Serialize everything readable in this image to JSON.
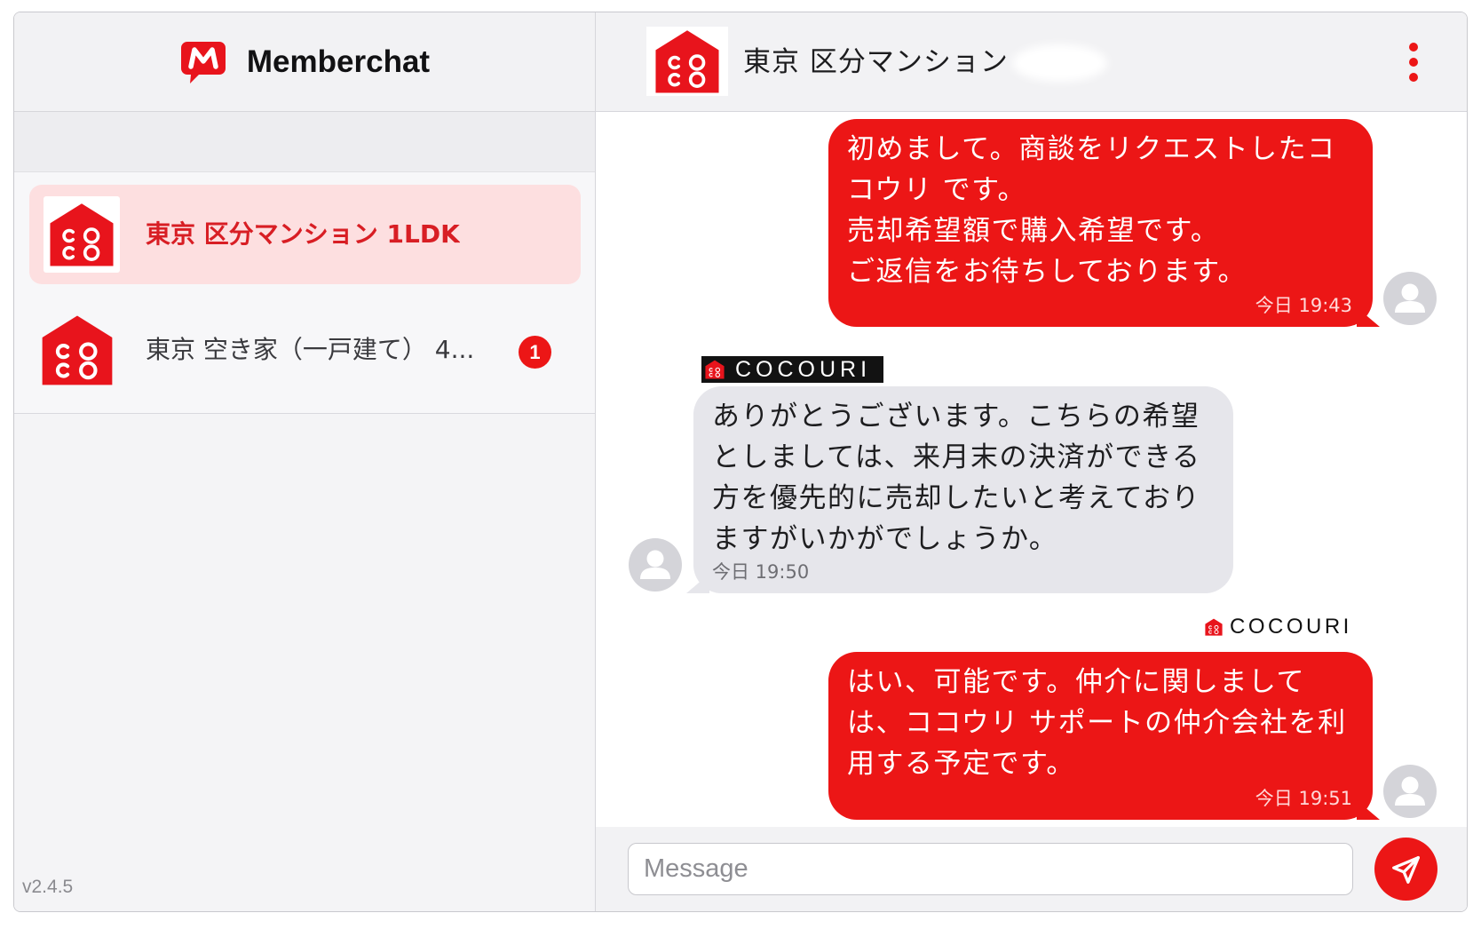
{
  "app": {
    "name": "Memberchat",
    "version": "v2.4.5"
  },
  "theme": {
    "accent": "#ec1616",
    "selected_row": "#fddfe0",
    "incoming_bubble": "#e6e6eb",
    "header_bg": "#f2f2f4"
  },
  "icons": {
    "app_logo": "memberchat-logo-icon",
    "app_logo_lettering": "M",
    "conversation_logo": "cocouri-house-icon",
    "conversation_logo_lettering": "COCO",
    "menu": "kebab-menu-icon",
    "avatar": "user-avatar-icon",
    "send": "paper-plane-icon"
  },
  "sidebar": {
    "conversations": [
      {
        "title": "東京 区分マンション 1LDK",
        "selected": true
      },
      {
        "title": "東京 空き家（一戸建て） 4...",
        "selected": false,
        "unread_count": 1
      }
    ]
  },
  "chat": {
    "title": "東京 区分マンション",
    "messages": [
      {
        "outgoing": true,
        "lines": [
          "初めまして。商談をリクエストしたコ",
          "コウリ です。",
          "売却希望額で購入希望です。",
          "ご返信をお待ちしております。"
        ],
        "time": "今日 19:43"
      },
      {
        "outgoing": false,
        "sender_label": "COCOURI",
        "lines": [
          "ありがとうございます。こちらの希望",
          "としましては、来月末の決済ができる",
          "方を優先的に売却したいと考えており",
          "ますがいかがでしょうか。"
        ],
        "time": "今日 19:50"
      },
      {
        "outgoing": true,
        "sender_label": "COCOURI",
        "lines": [
          "はい、可能です。仲介に関しまして",
          "は、ココウリ サポートの仲介会社を利",
          "用する予定です。"
        ],
        "time": "今日 19:51"
      }
    ],
    "composer": {
      "placeholder": "Message"
    }
  }
}
